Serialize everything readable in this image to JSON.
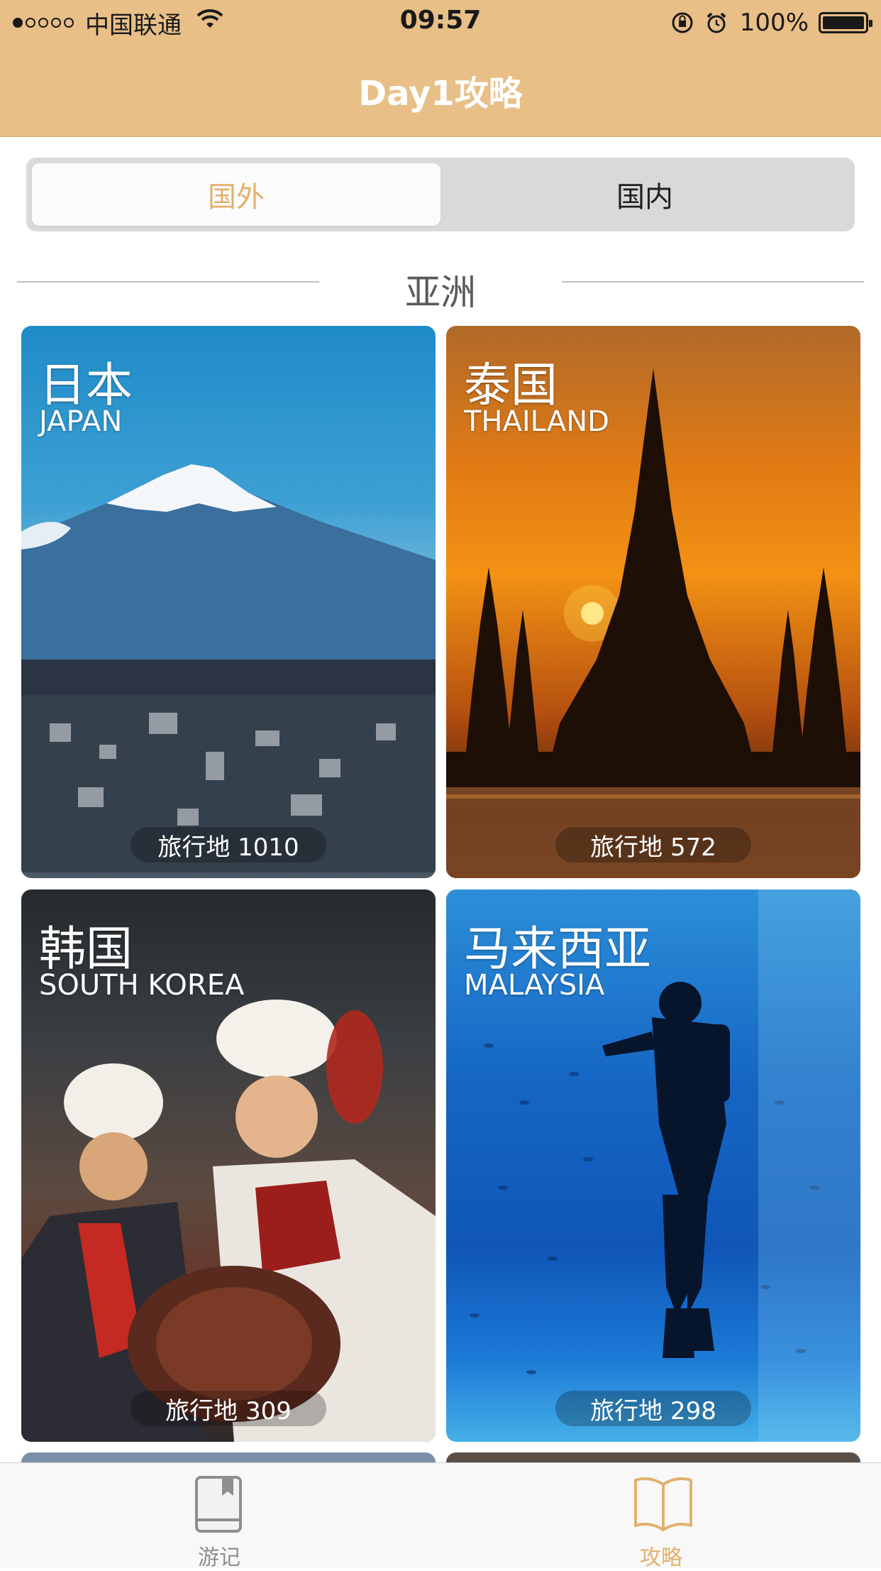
{
  "status_bar": {
    "carrier": "中国联通",
    "time": "09:57",
    "battery": "100%",
    "battery_level": 1.0,
    "signal_filled_dots": 1,
    "signal_total_dots": 5
  },
  "nav": {
    "title": "Day1攻略"
  },
  "segment": {
    "options": [
      "国外",
      "国内"
    ],
    "selected": "国外"
  },
  "section": {
    "title": "亚洲"
  },
  "cards": [
    {
      "cn": "日本",
      "en": "JAPAN",
      "count": "旅行地 1010"
    },
    {
      "cn": "泰国",
      "en": "THAILAND",
      "count": "旅行地 572"
    },
    {
      "cn": "韩国",
      "en": "SOUTH KOREA",
      "count": "旅行地 309"
    },
    {
      "cn": "马来西亚",
      "en": "MALAYSIA",
      "count": "旅行地 298"
    }
  ],
  "tabbar": {
    "items": [
      {
        "label": "游记",
        "icon": "book-icon",
        "active": false
      },
      {
        "label": "攻略",
        "icon": "open-book-icon",
        "active": true
      }
    ]
  },
  "colors": {
    "accent": "#e2b16d",
    "nav_background": "#e8bf87",
    "inactive_tab": "#8e8e8e"
  }
}
